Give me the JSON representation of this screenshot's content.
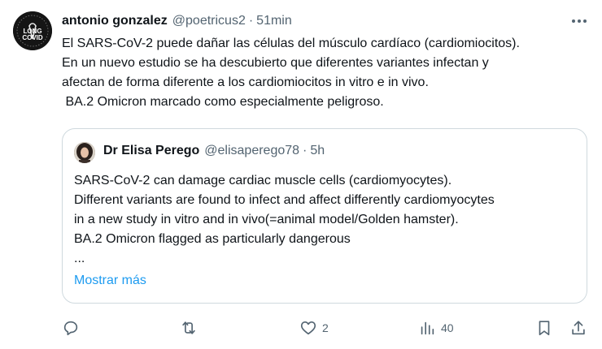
{
  "tweet": {
    "author_name": "antonio gonzalez",
    "author_handle": "@poetricus2",
    "separator": "·",
    "time": "51min",
    "avatar_text": [
      "LONG",
      "COVID"
    ],
    "body_lines": [
      "El SARS-CoV-2 puede dañar las células del músculo cardíaco (cardiomiocitos).",
      "En un nuevo estudio se ha descubierto que diferentes variantes infectan y",
      "afectan de forma diferente a los cardiomiocitos in vitro e in vivo.",
      " BA.2 Omicron marcado como especialmente peligroso."
    ]
  },
  "quote": {
    "author_name": "Dr Elisa Perego",
    "author_handle": "@elisaperego78",
    "separator": "·",
    "time": "5h",
    "body_lines": [
      "SARS-CoV-2 can damage cardiac muscle cells (cardiomyocytes).",
      "Different variants are found to infect and affect differently cardiomyocytes",
      "in a new study in vitro and in vivo(=animal model/Golden hamster).",
      "BA.2 Omicron flagged as particularly dangerous",
      "..."
    ],
    "show_more": "Mostrar más"
  },
  "actions": {
    "reply_icon": "reply-icon",
    "retweet_icon": "retweet-icon",
    "like_icon": "heart-icon",
    "like_count": "2",
    "views_icon": "views-icon",
    "views_count": "40",
    "bookmark_icon": "bookmark-icon",
    "share_icon": "share-icon"
  },
  "colors": {
    "text": "#0f1419",
    "secondary": "#536471",
    "link": "#1d9bf0",
    "border": "#cfd9de"
  }
}
